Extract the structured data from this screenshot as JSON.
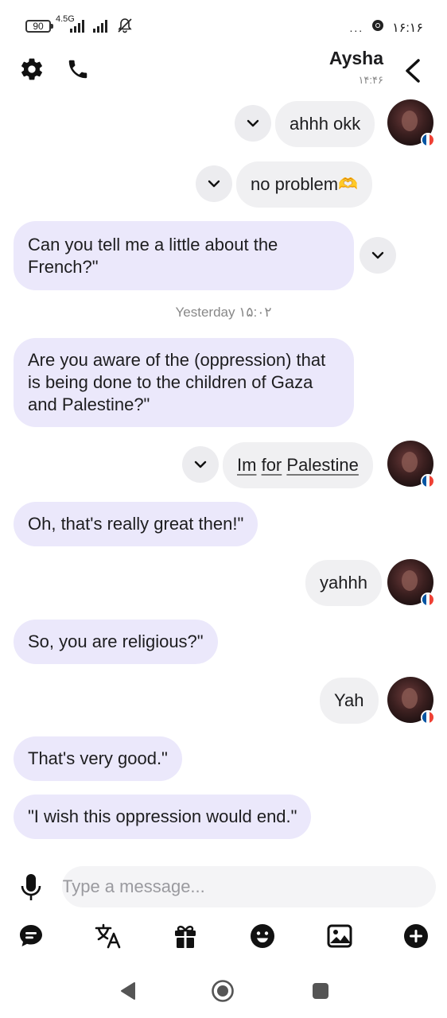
{
  "status_bar": {
    "battery": "90",
    "network": "4.5G",
    "more": "...",
    "time": "۱۶:۱۶"
  },
  "header": {
    "title": "Aysha",
    "subtitle": "۱۴:۴۶"
  },
  "messages": [
    {
      "side": "out",
      "text": "ahhh okk",
      "emoji": ""
    },
    {
      "side": "out",
      "text": "no problem",
      "emoji": "🫶"
    },
    {
      "side": "in",
      "text": "Can you tell me a little about the French?\""
    },
    {
      "side": "in",
      "text": "Are you aware of the (oppression) that is being done to the children of Gaza and Palestine?\""
    },
    {
      "side": "out",
      "text_parts": [
        "Im",
        " ",
        "for",
        " ",
        "Palestine"
      ]
    },
    {
      "side": "in",
      "text": "Oh, that's really great then!\""
    },
    {
      "side": "out",
      "text": "yahhh"
    },
    {
      "side": "in",
      "text": "So, you are religious?\""
    },
    {
      "side": "out",
      "text": "Yah"
    },
    {
      "side": "in",
      "text": "That's very good.\""
    },
    {
      "side": "in",
      "text": "\"I wish this oppression would end.\""
    }
  ],
  "date_separator": "Yesterday ۱۵:۰۲",
  "composer": {
    "placeholder": "Type a message..."
  },
  "colors": {
    "incoming_bubble": "#ebe8fb",
    "outgoing_bubble": "#f0f0f2",
    "icon": "#111111"
  },
  "icons": {
    "header": [
      "gear-icon",
      "phone-icon",
      "back-chevron-icon"
    ],
    "toolbar": [
      "chat-icon",
      "translate-icon",
      "gift-icon",
      "emoji-icon",
      "image-icon",
      "plus-icon"
    ],
    "nav": [
      "nav-back-icon",
      "nav-home-icon",
      "nav-recents-icon"
    ]
  }
}
